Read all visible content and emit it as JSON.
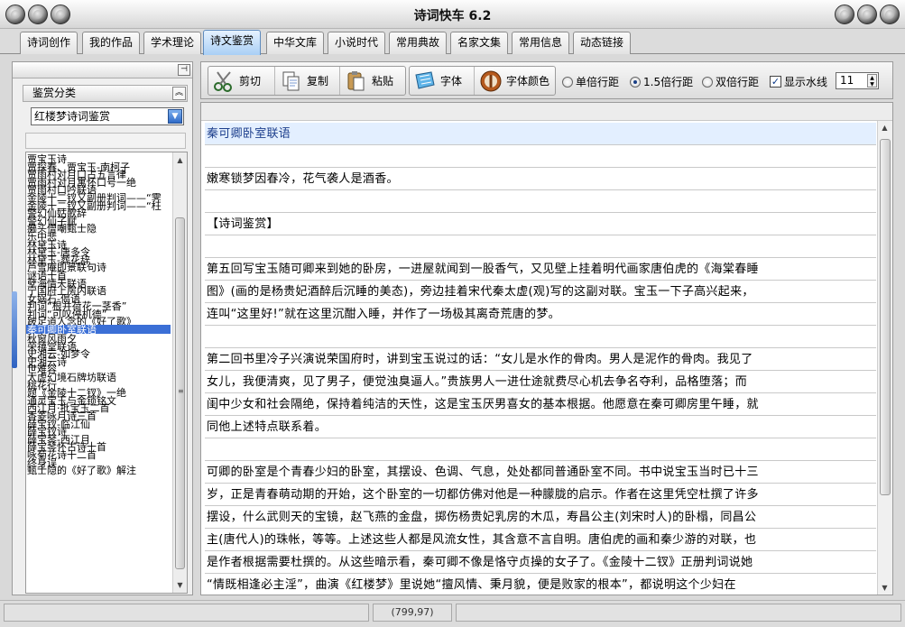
{
  "window": {
    "title": "诗词快车 6.2"
  },
  "tabs": [
    {
      "label": "诗词创作"
    },
    {
      "label": "我的作品"
    },
    {
      "label": "学术理论"
    },
    {
      "label": "诗文鉴赏",
      "active": true
    },
    {
      "label": "中华文库"
    },
    {
      "label": "小说时代"
    },
    {
      "label": "常用典故"
    },
    {
      "label": "名家文集"
    },
    {
      "label": "常用信息"
    },
    {
      "label": "动态链接"
    }
  ],
  "sidebar": {
    "category_header": "鉴赏分类",
    "category_select": "红楼梦诗词鉴赏",
    "items": [
      "贾宝玉诗",
      "贾探春、贾宝玉-南柯子",
      "贾雨村对月口占五言律",
      "贾雨村对月寓怀口号一绝",
      "贾雨村口吟联语",
      "金陵十二钗又副册判词——“霁",
      "金陵十二钗又副册判词——“枉",
      "警幻仙姑歌辞",
      "警幻仙子赋",
      "癞头僧嘲甄士隐",
      "乐中悲",
      "林黛玉诗",
      "林黛玉-唐多令",
      "林黛玉-葬花辞",
      "芦雪庵即景联句诗",
      "谜语十首",
      "孽海情天联语",
      "宁国府上房内联语",
      "女娲石-偈语",
      "判词“根并荷花一茎香”",
      "判词“可叹停机德”",
      "跛足道人念的《好了歌》",
      "秦可卿卧室联语",
      "秋窗风雨夕",
      "荣禧堂联语",
      "史湘云-如梦令",
      "史湘云诗",
      "世难容",
      "太虚幻境石牌坊联语",
      "桃花行",
      "题《金陵十二钗》一绝",
      "通灵宝玉与金锁铭文",
      "西江月·批宝玉二首",
      "香菱咏月诗三首",
      "薛宝钗-临江仙",
      "薛宝钗诗",
      "薛宝琴-西江月",
      "薛宝琴怀古诗十首",
      "咏菊花诗十二首",
      "终身误",
      "甄士隐的《好了歌》解注"
    ],
    "selected_index": 22
  },
  "toolbar": {
    "cut": "剪切",
    "copy": "复制",
    "paste": "粘贴",
    "font": "字体",
    "font_color": "字体颜色",
    "spacing_single": "单倍行距",
    "spacing_15": "1.5倍行距",
    "spacing_double": "双倍行距",
    "show_watermark": "显示水线",
    "font_size": "11",
    "selected_spacing": "1.5倍行距",
    "watermark_checked": true
  },
  "content": {
    "lines": [
      {
        "text": "秦可卿卧室联语",
        "type": "head"
      },
      {
        "text": ""
      },
      {
        "text": "嫩寒锁梦因春冷，花气袭人是酒香。"
      },
      {
        "text": ""
      },
      {
        "text": "【诗词鉴赏】"
      },
      {
        "text": ""
      },
      {
        "text": "第五回写宝玉随可卿来到她的卧房，一进屋就闻到一股香气，又见壁上挂着明代画家唐伯虎的《海棠春睡"
      },
      {
        "text": "图》(画的是杨贵妃酒醉后沉睡的美态)，旁边挂着宋代秦太虚(观)写的这副对联。宝玉一下子高兴起来，"
      },
      {
        "text": "连叫“这里好!”就在这里沉酣入睡，并作了一场极其离奇荒唐的梦。"
      },
      {
        "text": ""
      },
      {
        "text": "第二回书里冷子兴演说荣国府时，讲到宝玉说过的话：“女儿是水作的骨肉。男人是泥作的骨肉。我见了"
      },
      {
        "text": "女儿，我便清爽，见了男子，便觉浊臭逼人。”贵族男人一进仕途就费尽心机去争名夺利，品格堕落；而"
      },
      {
        "text": "闺中少女和社会隔绝，保持着纯洁的天性，这是宝玉厌男喜女的基本根据。他愿意在秦可卿房里午睡，就"
      },
      {
        "text": "同他上述特点联系着。"
      },
      {
        "text": ""
      },
      {
        "text": "可卿的卧室是个青春少妇的卧室，其摆设、色调、气息，处处都同普通卧室不同。书中说宝玉当时已十三"
      },
      {
        "text": "岁，正是青春萌动期的开始，这个卧室的一切都仿佛对他是一种朦胧的启示。作者在这里凭空杜撰了许多"
      },
      {
        "text": "摆设，什么武则天的宝镜，赵飞燕的金盘，掷伤杨贵妃乳房的木瓜，寿昌公主(刘宋时人)的卧榻，同昌公"
      },
      {
        "text": "主(唐代人)的珠帐，等等。上述这些人都是风流女性，其含意不言自明。唐伯虎的画和秦少游的对联，也"
      },
      {
        "text": "是作者根据需要杜撰的。从这些暗示看，秦可卿不像是恪守贞操的女子了。《金陵十二钗》正册判词说她"
      },
      {
        "text": "“情既相逢必主淫”，曲演《红楼梦》里说她“擅风情、秉月貌，便是败家的根本”，都说明这个少妇在"
      }
    ]
  },
  "status": {
    "coords": "(799,97)"
  }
}
